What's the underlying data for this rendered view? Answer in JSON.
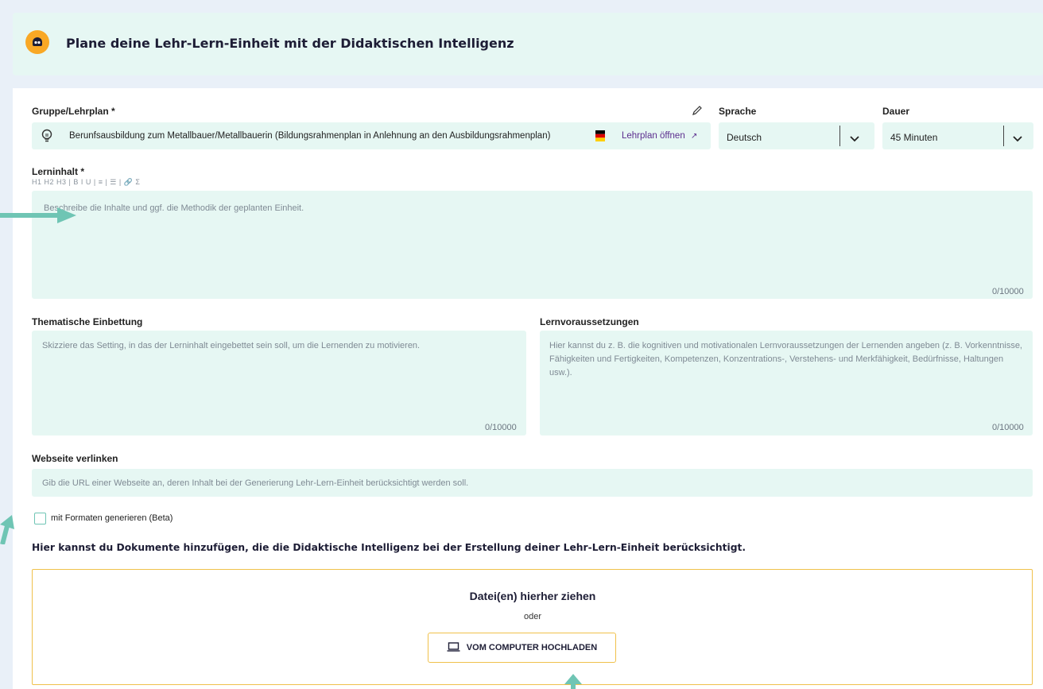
{
  "header": {
    "title": "Plane deine Lehr-Lern-Einheit mit der Didaktischen Intelligenz"
  },
  "group": {
    "label": "Gruppe/Lehrplan *",
    "value": "Berunfsausbildung zum Metallbauer/Metallbauerin (Bildungsrahmenplan in Anlehnung an den Ausbildungsrahmenplan)",
    "link": "Lehrplan öffnen"
  },
  "language": {
    "label": "Sprache",
    "value": "Deutsch"
  },
  "duration": {
    "label": "Dauer",
    "value": "45 Minuten"
  },
  "content": {
    "label": "Lerninhalt *",
    "toolbar": "H1 H2 H3 | B I U | ≡ | ☰ | 🔗 Σ",
    "placeholder": "Beschreibe die Inhalte und ggf. die Methodik der geplanten Einheit.",
    "counter": "0/10000"
  },
  "embedding": {
    "label": "Thematische Einbettung",
    "placeholder": "Skizziere das Setting, in das der Lerninhalt eingebettet sein soll, um die Lernenden zu motivieren.",
    "counter": "0/10000"
  },
  "prerequisites": {
    "label": "Lernvoraussetzungen",
    "placeholder": "Hier kannst du z. B. die kognitiven und motivationalen Lernvoraussetzungen der Lernenden angeben (z. B. Vorkenntnisse, Fähigkeiten und Fertigkeiten, Kompetenzen, Konzentrations-, Verstehens- und Merkfähigkeit, Bedürfnisse, Haltungen usw.).",
    "counter": "0/10000"
  },
  "website": {
    "label": "Webseite verlinken",
    "placeholder": "Gib die URL einer Webseite an, deren Inhalt bei der Generierung Lehr-Lern-Einheit berücksichtigt werden soll."
  },
  "formats": {
    "label": "mit Formaten generieren (Beta)"
  },
  "documents": {
    "heading": "Hier kannst du Dokumente hinzufügen, die die Didaktische Intelligenz bei der Erstellung deiner Lehr-Lern-Einheit berücksichtigt.",
    "drop_text": "Datei(en) hierher ziehen",
    "or_text": "oder",
    "button_label": "VOM COMPUTER HOCHLADEN"
  },
  "colors": {
    "accent": "#6fc5b4",
    "field_bg": "#e6f7f3",
    "upload_border": "#f0c14b",
    "bot_icon": "#f9a825",
    "link": "#5b2d8e"
  }
}
